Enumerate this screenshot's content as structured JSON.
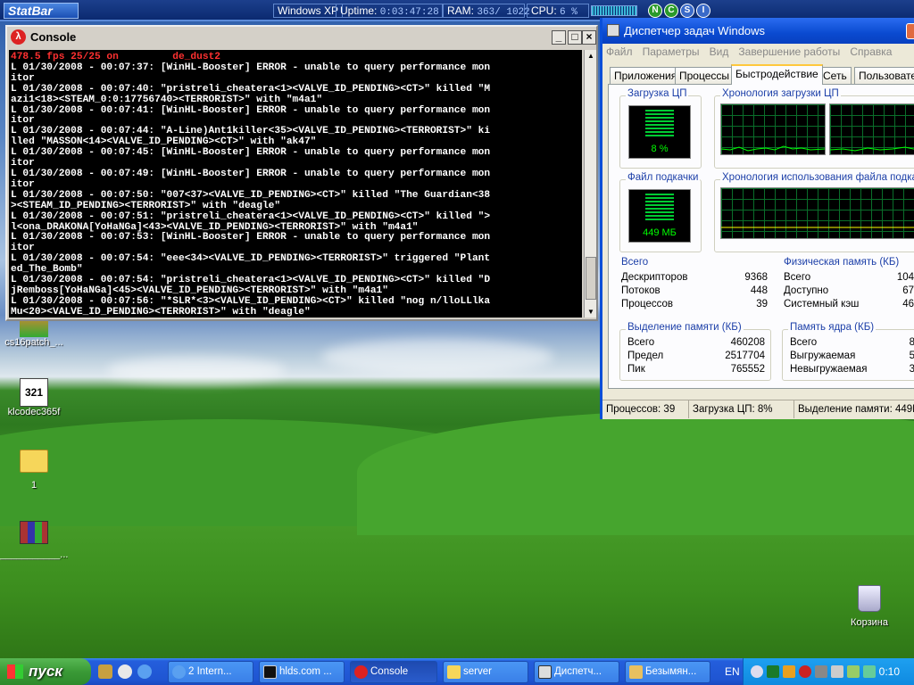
{
  "statbar": {
    "logo": "StatBar",
    "os": "Windows XP",
    "uptime_label": "Uptime:",
    "uptime_value": "0:03:47:28",
    "ram_label": "RAM:",
    "ram_value": "363/ 1022",
    "cpu_label": "CPU:",
    "cpu_value": "6 %",
    "buttons": [
      "N",
      "C",
      "S",
      "I"
    ]
  },
  "console": {
    "title": "Console",
    "status_line": "478.5 fps 25/25 on         de_dust2",
    "lines": [
      "L 01/30/2008 - 00:07:37: [WinHL-Booster] ERROR - unable to query performance mon",
      "itor",
      "L 01/30/2008 - 00:07:40: \"pristreli_cheatera<1><VALVE_ID_PENDING><CT>\" killed \"M",
      "azi1<18><STEAM_0:0:17756740><TERRORIST>\" with \"m4a1\"",
      "L 01/30/2008 - 00:07:41: [WinHL-Booster] ERROR - unable to query performance mon",
      "itor",
      "L 01/30/2008 - 00:07:44: \"A-Line)Ant1killer<35><VALVE_ID_PENDING><TERRORIST>\" ki",
      "lled \"MASSON<14><VALVE_ID_PENDING><CT>\" with \"ak47\"",
      "L 01/30/2008 - 00:07:45: [WinHL-Booster] ERROR - unable to query performance mon",
      "itor",
      "L 01/30/2008 - 00:07:49: [WinHL-Booster] ERROR - unable to query performance mon",
      "itor",
      "L 01/30/2008 - 00:07:50: \"007<37><VALVE_ID_PENDING><CT>\" killed \"The Guardian<38",
      "><STEAM_ID_PENDING><TERRORIST>\" with \"deagle\"",
      "L 01/30/2008 - 00:07:51: \"pristreli_cheatera<1><VALVE_ID_PENDING><CT>\" killed \">",
      "l<ona_DRAKONA[YoHaNGa]<43><VALVE_ID_PENDING><TERRORIST>\" with \"m4a1\"",
      "L 01/30/2008 - 00:07:53: [WinHL-Booster] ERROR - unable to query performance mon",
      "itor",
      "L 01/30/2008 - 00:07:54: \"eee<34><VALVE_ID_PENDING><TERRORIST>\" triggered \"Plant",
      "ed_The_Bomb\"",
      "L 01/30/2008 - 00:07:54: \"pristreli_cheatera<1><VALVE_ID_PENDING><CT>\" killed \"D",
      "jRemboss[YoHaNGa]<45><VALVE_ID_PENDING><TERRORIST>\" with \"m4a1\"",
      "L 01/30/2008 - 00:07:56: \"*SLR*<3><VALVE_ID_PENDING><CT>\" killed \"nog n/lloLLlka",
      "Mu<20><VALVE_ID_PENDING><TERRORIST>\" with \"deagle\""
    ]
  },
  "taskmgr": {
    "title": "Диспетчер задач Windows",
    "menu": [
      "Файл",
      "Параметры",
      "Вид",
      "Завершение работы",
      "Справка"
    ],
    "tabs": [
      "Приложения",
      "Процессы",
      "Быстродействие",
      "Сеть",
      "Пользовате..."
    ],
    "active_tab": "Быстродействие",
    "cpu_usage_label": "Загрузка ЦП",
    "cpu_usage_value": "8 %",
    "cpu_history_label": "Хронология загрузки ЦП",
    "pagefile_label": "Файл подкачки",
    "pagefile_value": "449 МБ",
    "pagefile_history_label": "Хронология использования файла подкачки",
    "totals": {
      "label": "Всего",
      "rows": [
        {
          "name": "Дескрипторов",
          "value": "9368"
        },
        {
          "name": "Потоков",
          "value": "448"
        },
        {
          "name": "Процессов",
          "value": "39"
        }
      ]
    },
    "physical": {
      "label": "Физическая память (КБ)",
      "rows": [
        {
          "name": "Всего",
          "value": "104"
        },
        {
          "name": "Доступно",
          "value": "67"
        },
        {
          "name": "Системный кэш",
          "value": "46"
        }
      ]
    },
    "commit": {
      "label": "Выделение памяти (КБ)",
      "rows": [
        {
          "name": "Всего",
          "value": "460208"
        },
        {
          "name": "Предел",
          "value": "2517704"
        },
        {
          "name": "Пик",
          "value": "765552"
        }
      ]
    },
    "kernel": {
      "label": "Память ядра (КБ)",
      "rows": [
        {
          "name": "Всего",
          "value": "8"
        },
        {
          "name": "Выгружаемая",
          "value": "5"
        },
        {
          "name": "Невыгружаемая",
          "value": "3"
        }
      ]
    },
    "status": {
      "processes": "Процессов: 39",
      "cpu": "Загрузка ЦП: 8%",
      "commit": "Выделение памяти: 449M"
    }
  },
  "desktop": {
    "icons": [
      {
        "label": "cs16patch_..."
      },
      {
        "label": "klcodec365f"
      },
      {
        "label": "1"
      },
      {
        "label": "___________..."
      },
      {
        "label": "Корзина"
      }
    ]
  },
  "taskbar": {
    "start_label": "пуск",
    "buttons": [
      {
        "label": "2 Intern...",
        "icon": "ie-icon"
      },
      {
        "label": "hlds.com ...",
        "icon": "cmd-icon"
      },
      {
        "label": "Console",
        "icon": "halflife-icon"
      },
      {
        "label": "server",
        "icon": "folder-icon"
      },
      {
        "label": "Диспетч...",
        "icon": "taskmgr-icon"
      },
      {
        "label": "Безымян...",
        "icon": "paint-icon"
      }
    ],
    "lang": "EN",
    "clock": "0:10"
  }
}
